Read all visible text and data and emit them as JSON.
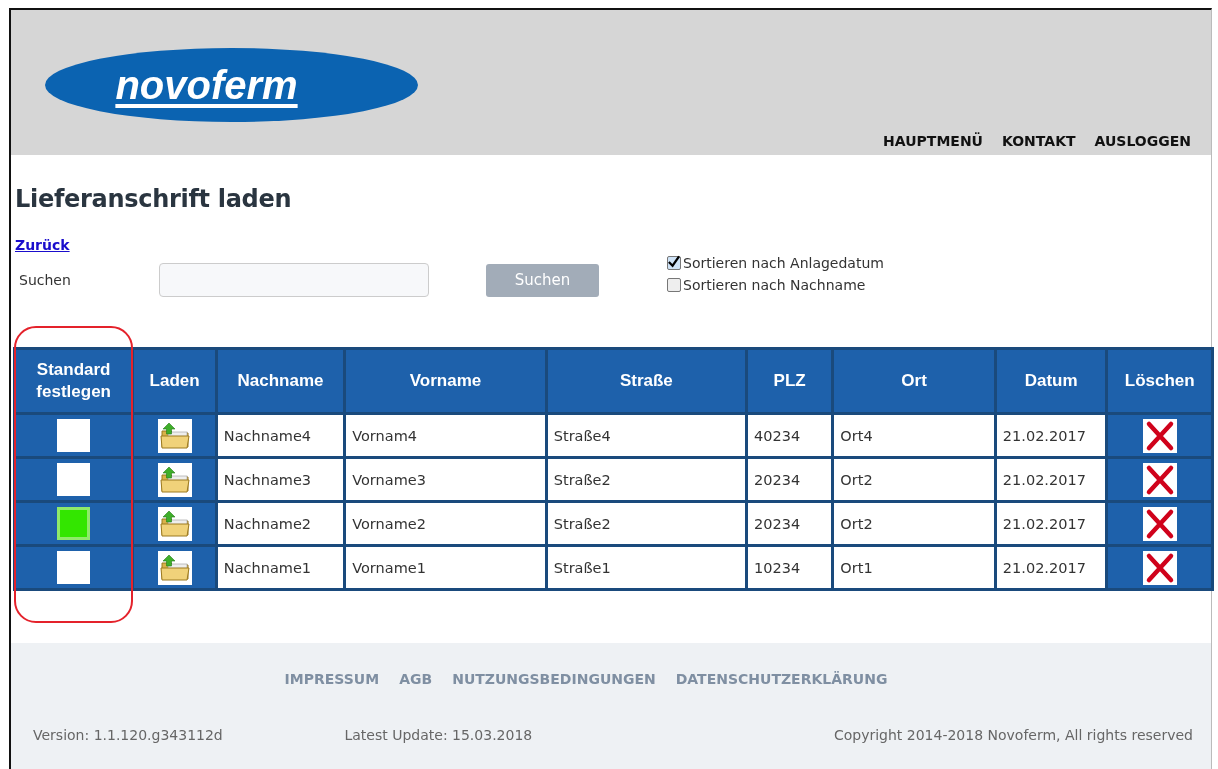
{
  "header": {
    "logo": "novoferm",
    "nav": [
      "HAUPTMENÜ",
      "KONTAKT",
      "AUSLOGGEN"
    ]
  },
  "title": "Lieferanschrift laden",
  "back_link": "Zurück",
  "search": {
    "label": "Suchen",
    "button": "Suchen"
  },
  "sort_options": [
    {
      "label": "Sortieren nach Anlagedatum",
      "checked": true
    },
    {
      "label": "Sortieren nach Nachname",
      "checked": false
    }
  ],
  "table": {
    "columns": [
      "Standard festlegen",
      "Laden",
      "Nachname",
      "Vorname",
      "Straße",
      "PLZ",
      "Ort",
      "Datum",
      "Löschen"
    ],
    "rows": [
      {
        "default": false,
        "nachname": "Nachname4",
        "vorname": "Vornam4",
        "strasse": "Straße4",
        "plz": "40234",
        "ort": "Ort4",
        "datum": "21.02.2017"
      },
      {
        "default": false,
        "nachname": "Nachname3",
        "vorname": "Vorname3",
        "strasse": "Straße2",
        "plz": "20234",
        "ort": "Ort2",
        "datum": "21.02.2017"
      },
      {
        "default": true,
        "nachname": "Nachname2",
        "vorname": "Vorname2",
        "strasse": "Straße2",
        "plz": "20234",
        "ort": "Ort2",
        "datum": "21.02.2017"
      },
      {
        "default": false,
        "nachname": "Nachname1",
        "vorname": "Vorname1",
        "strasse": "Straße1",
        "plz": "10234",
        "ort": "Ort1",
        "datum": "21.02.2017"
      }
    ]
  },
  "footer": {
    "links": [
      "IMPRESSUM",
      "AGB",
      "NUTZUNGSBEDINGUNGEN",
      "DATENSCHUTZERKLÄRUNG"
    ],
    "version": "Version: 1.1.120.g343112d",
    "update": "Latest Update: 15.03.2018",
    "copyright": "Copyright 2014-2018 Novoferm, All rights reserved"
  }
}
